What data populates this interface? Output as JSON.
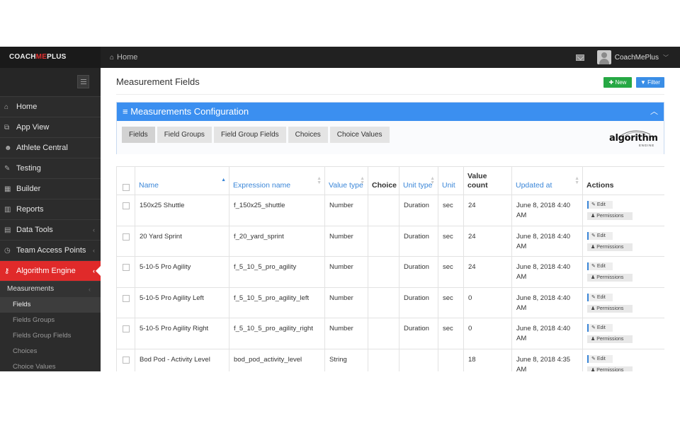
{
  "topbar": {
    "brand_prefix": "COACH",
    "brand_highlight": "ME",
    "brand_suffix": "PLUS",
    "home_label": "Home",
    "user_name": "CoachMePlus"
  },
  "sidebar": {
    "items": [
      {
        "label": "Home",
        "icon": "home-icon",
        "glyph": "⌂"
      },
      {
        "label": "App View",
        "icon": "external-link-icon",
        "glyph": "⧉"
      },
      {
        "label": "Athlete Central",
        "icon": "users-icon",
        "glyph": "☻"
      },
      {
        "label": "Testing",
        "icon": "edit-icon",
        "glyph": "✎"
      },
      {
        "label": "Builder",
        "icon": "calendar-icon",
        "glyph": "▦"
      },
      {
        "label": "Reports",
        "icon": "chart-icon",
        "glyph": "▥"
      },
      {
        "label": "Data Tools",
        "icon": "table-icon",
        "glyph": "▤"
      },
      {
        "label": "Team Access Points",
        "icon": "clock-icon",
        "glyph": "◷"
      },
      {
        "label": "Algorithm Engine",
        "icon": "key-icon",
        "glyph": "⚷"
      }
    ],
    "sub_header": "Measurements",
    "sub_items": [
      "Fields",
      "Fields Groups",
      "Fields Group Fields",
      "Choices",
      "Choice Values"
    ]
  },
  "main": {
    "page_title": "Measurement Fields",
    "new_label": "New",
    "filter_label": "Filter",
    "panel_title": "Measurements Configuration",
    "tabs": [
      "Fields",
      "Field Groups",
      "Field Group Fields",
      "Choices",
      "Choice Values"
    ],
    "logo_word": "algorithm",
    "logo_sub": "ENGINE"
  },
  "table": {
    "columns": [
      "Name",
      "Expression name",
      "Value type",
      "Choice",
      "Unit type",
      "Unit",
      "Value count",
      "Updated at",
      "Actions"
    ],
    "edit_label": "Edit",
    "permissions_label": "Permissions",
    "rows": [
      {
        "name": "150x25 Shuttle",
        "expression": "f_150x25_shuttle",
        "value_type": "Number",
        "choice": "",
        "unit_type": "Duration",
        "unit": "sec",
        "count": "24",
        "updated": "June 8, 2018 4:40 AM"
      },
      {
        "name": "20 Yard Sprint",
        "expression": "f_20_yard_sprint",
        "value_type": "Number",
        "choice": "",
        "unit_type": "Duration",
        "unit": "sec",
        "count": "24",
        "updated": "June 8, 2018 4:40 AM"
      },
      {
        "name": "5-10-5 Pro Agility",
        "expression": "f_5_10_5_pro_agility",
        "value_type": "Number",
        "choice": "",
        "unit_type": "Duration",
        "unit": "sec",
        "count": "24",
        "updated": "June 8, 2018 4:40 AM"
      },
      {
        "name": "5-10-5 Pro Agility Left",
        "expression": "f_5_10_5_pro_agility_left",
        "value_type": "Number",
        "choice": "",
        "unit_type": "Duration",
        "unit": "sec",
        "count": "0",
        "updated": "June 8, 2018 4:40 AM"
      },
      {
        "name": "5-10-5 Pro Agility Right",
        "expression": "f_5_10_5_pro_agility_right",
        "value_type": "Number",
        "choice": "",
        "unit_type": "Duration",
        "unit": "sec",
        "count": "0",
        "updated": "June 8, 2018 4:40 AM"
      },
      {
        "name": "Bod Pod - Activity Level",
        "expression": "bod_pod_activity_level",
        "value_type": "String",
        "choice": "",
        "unit_type": "",
        "unit": "",
        "count": "18",
        "updated": "June 8, 2018 4:35 AM"
      }
    ]
  }
}
